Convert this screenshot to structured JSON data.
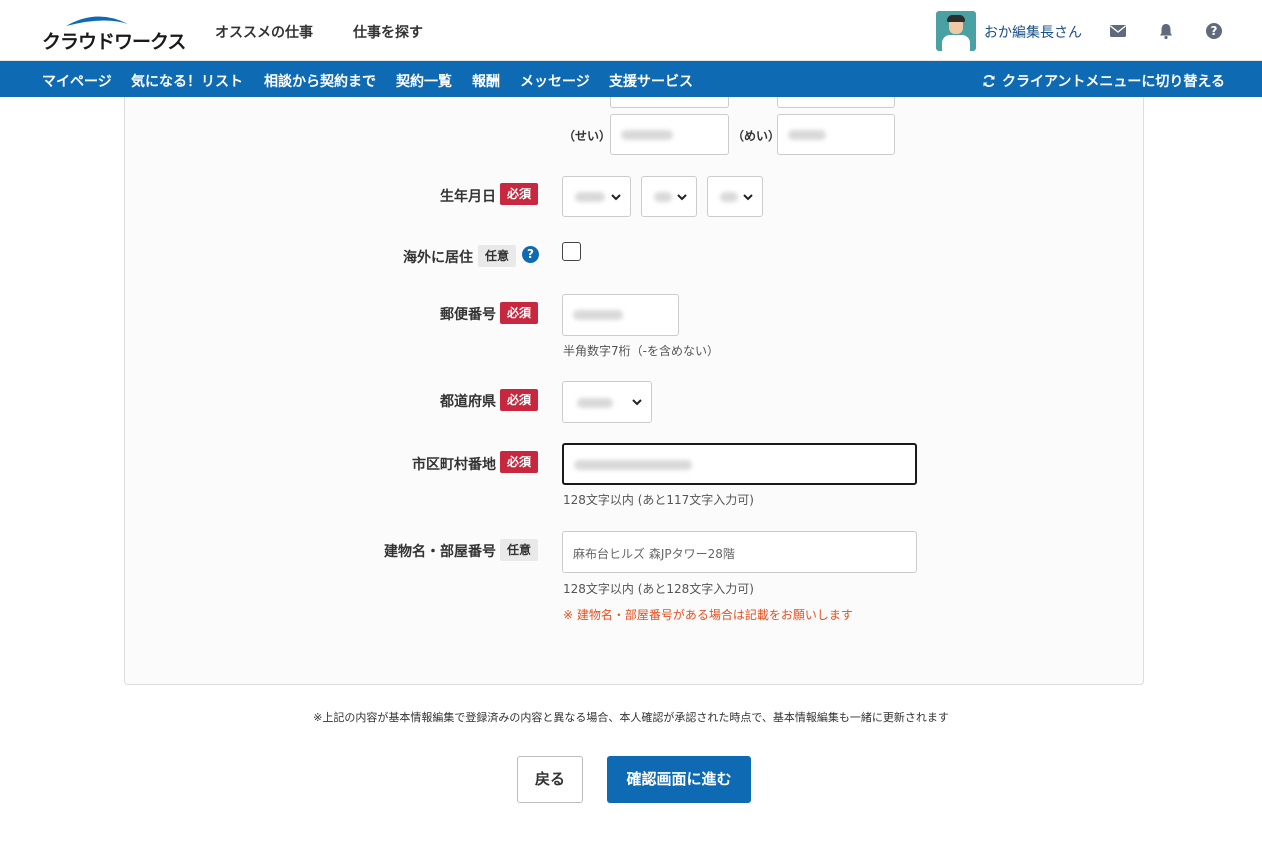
{
  "header": {
    "logo_text": "クラウドワークス",
    "nav": [
      "オススメの仕事",
      "仕事を探す"
    ],
    "user_name": "おか編集長さん",
    "icons": [
      "envelope-icon",
      "bell-icon",
      "help-icon"
    ]
  },
  "subnav": {
    "items": [
      "マイページ",
      "気になる！リスト",
      "相談から契約まで",
      "契約一覧",
      "報酬",
      "メッセージ",
      "支援サービス"
    ],
    "switch_label": "クライアントメニューに切り替える"
  },
  "form": {
    "name_kana": {
      "sei_label": "（せい）",
      "mei_label": "（めい）"
    },
    "birthdate": {
      "label": "生年月日",
      "badge": "必須"
    },
    "overseas": {
      "label": "海外に居住",
      "badge": "任意",
      "help": "?",
      "checked": false
    },
    "postal": {
      "label": "郵便番号",
      "badge": "必須",
      "hint": "半角数字7桁（-を含めない）"
    },
    "prefecture": {
      "label": "都道府県",
      "badge": "必須"
    },
    "city": {
      "label": "市区町村番地",
      "badge": "必須",
      "hint": "128文字以内 (あと117文字入力可)"
    },
    "building": {
      "label": "建物名・部屋番号",
      "badge": "任意",
      "placeholder": "麻布台ヒルズ 森JPタワー28階",
      "hint": "128文字以内 (あと128文字入力可)",
      "warning": "※ 建物名・部屋番号がある場合は記載をお願いします"
    }
  },
  "footer": {
    "note": "※上記の内容が基本情報編集で登録済みの内容と異なる場合、本人確認が承認された時点で、基本情報編集も一緒に更新されます",
    "back_label": "戻る",
    "next_label": "確認画面に進む"
  },
  "colors": {
    "brand_blue": "#0f6ab4",
    "required_red": "#c8283f",
    "warning_orange": "#e8501e"
  }
}
